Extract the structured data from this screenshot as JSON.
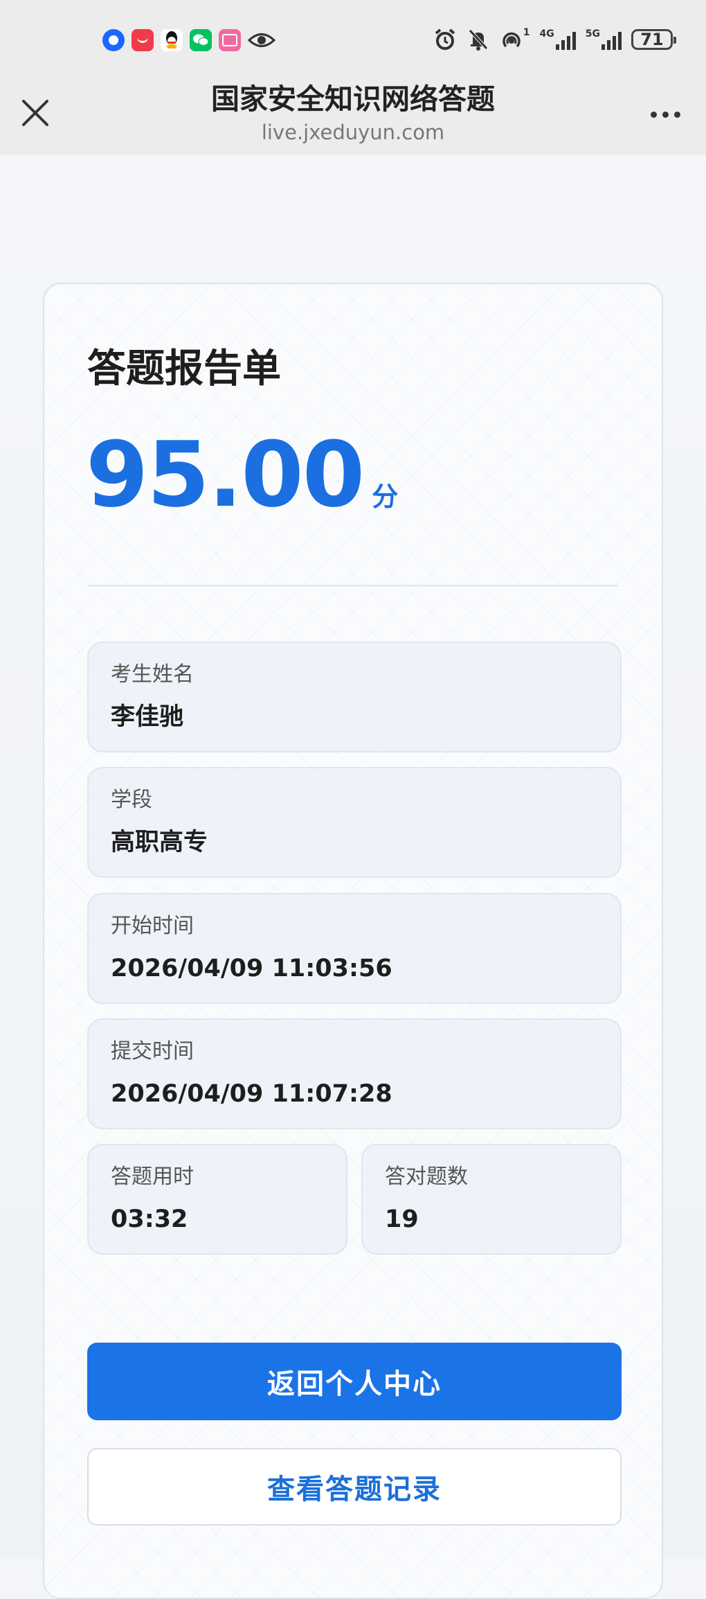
{
  "status_bar": {
    "apps": [
      "browser-icon",
      "red-app-icon",
      "qq-icon",
      "wechat-icon",
      "pink-app-icon",
      "eye-icon"
    ],
    "network": [
      "4G",
      "5G"
    ],
    "sim_mark": "1",
    "battery": "71"
  },
  "header": {
    "title": "国家安全知识网络答题",
    "url": "live.jxeduyun.com"
  },
  "report": {
    "title": "答题报告单",
    "score": "95.00",
    "score_unit": "分",
    "fields": {
      "name": {
        "label": "考生姓名",
        "value": "李佳驰"
      },
      "stage": {
        "label": "学段",
        "value": "高职高专"
      },
      "start_time": {
        "label": "开始时间",
        "value": "2026/04/09 11:03:56"
      },
      "submit_time": {
        "label": "提交时间",
        "value": "2026/04/09 11:07:28"
      },
      "duration": {
        "label": "答题用时",
        "value": "03:32"
      },
      "correct_count": {
        "label": "答对题数",
        "value": "19"
      }
    }
  },
  "actions": {
    "back_label": "返回个人中心",
    "records_label": "查看答题记录"
  },
  "colors": {
    "accent": "#1b73e8",
    "score": "#1b6fe0"
  }
}
